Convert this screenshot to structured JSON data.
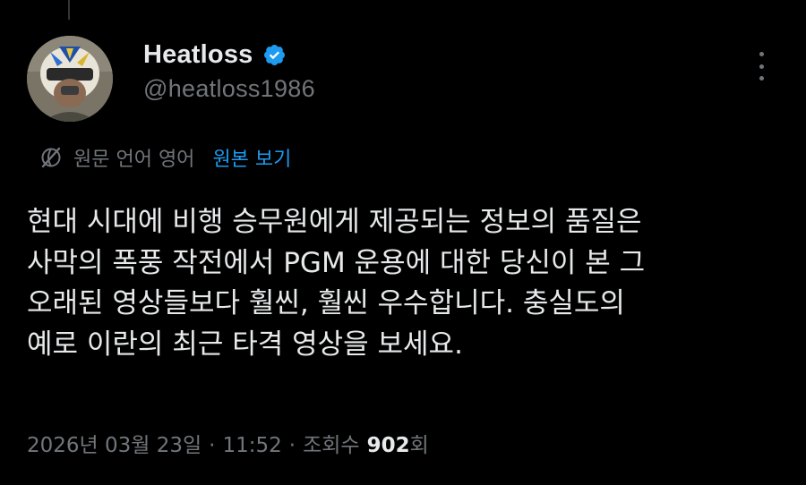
{
  "tweet": {
    "author": {
      "display_name": "Heatloss",
      "handle": "@heatloss1986",
      "verified": true,
      "verified_icon": "verified-badge-icon",
      "avatar_icon": "pilot-helmet-avatar"
    },
    "more_icon": "more-vertical-icon",
    "translation": {
      "icon": "translate-globe-icon",
      "note": "원문 언어 영어",
      "show_original_label": "원본 보기"
    },
    "text_lines": [
      "현대 시대에 비행 승무원에게 제공되는 정보의 품질은",
      "사막의 폭풍 작전에서 PGM 운용에 대한 당신이 본 그",
      "오래된 영상들보다 훨씬, 훨씬 우수합니다. 충실도의",
      "예로 이란의 최근 타격 영상을 보세요."
    ],
    "meta": {
      "date": "2026년 03월 23일",
      "separator": "·",
      "time": "11:52",
      "views_label": "조회수",
      "views_count": "902",
      "views_suffix": "회"
    }
  },
  "colors": {
    "background": "#000000",
    "text_primary": "#e7e9ea",
    "text_secondary": "#71767b",
    "link": "#1d9bf0",
    "verified": "#1d9bf0"
  }
}
